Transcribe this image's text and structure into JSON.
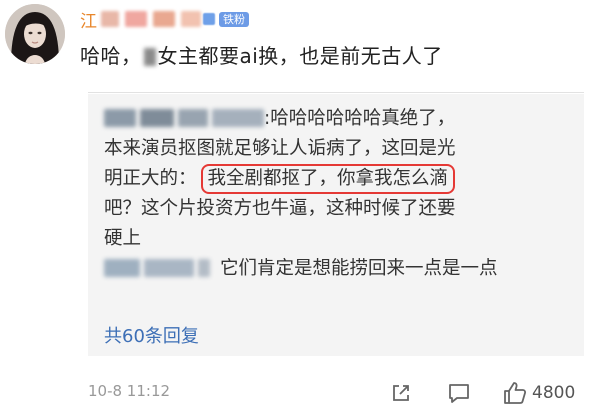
{
  "comment": {
    "username_prefix": "江",
    "fan_badge": "铁粉",
    "text_before": "哈哈，",
    "text_after": "女主都要ai换，也是前无古人了"
  },
  "reply": {
    "name_suffix": ":",
    "line1": "哈哈哈哈哈哈真绝了，",
    "line2": "本来演员抠图就足够让人诟病了，这回是光",
    "line3_prefix": "明正大的：",
    "line3_highlight": "我全剧都抠了，你拿我怎么滴",
    "line4": "吧？这个片投资方也牛逼，这种时候了还要",
    "line5": "硬上",
    "line6": "它们肯定是想能捞回来一点是一点"
  },
  "more_replies": "共60条回复",
  "footer": {
    "timestamp": "10-8 11:12",
    "like_count": "4800"
  },
  "colors": {
    "username": "#e8862a",
    "fan_badge": "#6d9be6",
    "link": "#3d6fb6",
    "highlight_border": "#e53935",
    "reply_bg": "#f4f4f4"
  },
  "icons": [
    "avatar",
    "vip-badge-icon",
    "share-icon",
    "comment-icon",
    "like-icon"
  ]
}
